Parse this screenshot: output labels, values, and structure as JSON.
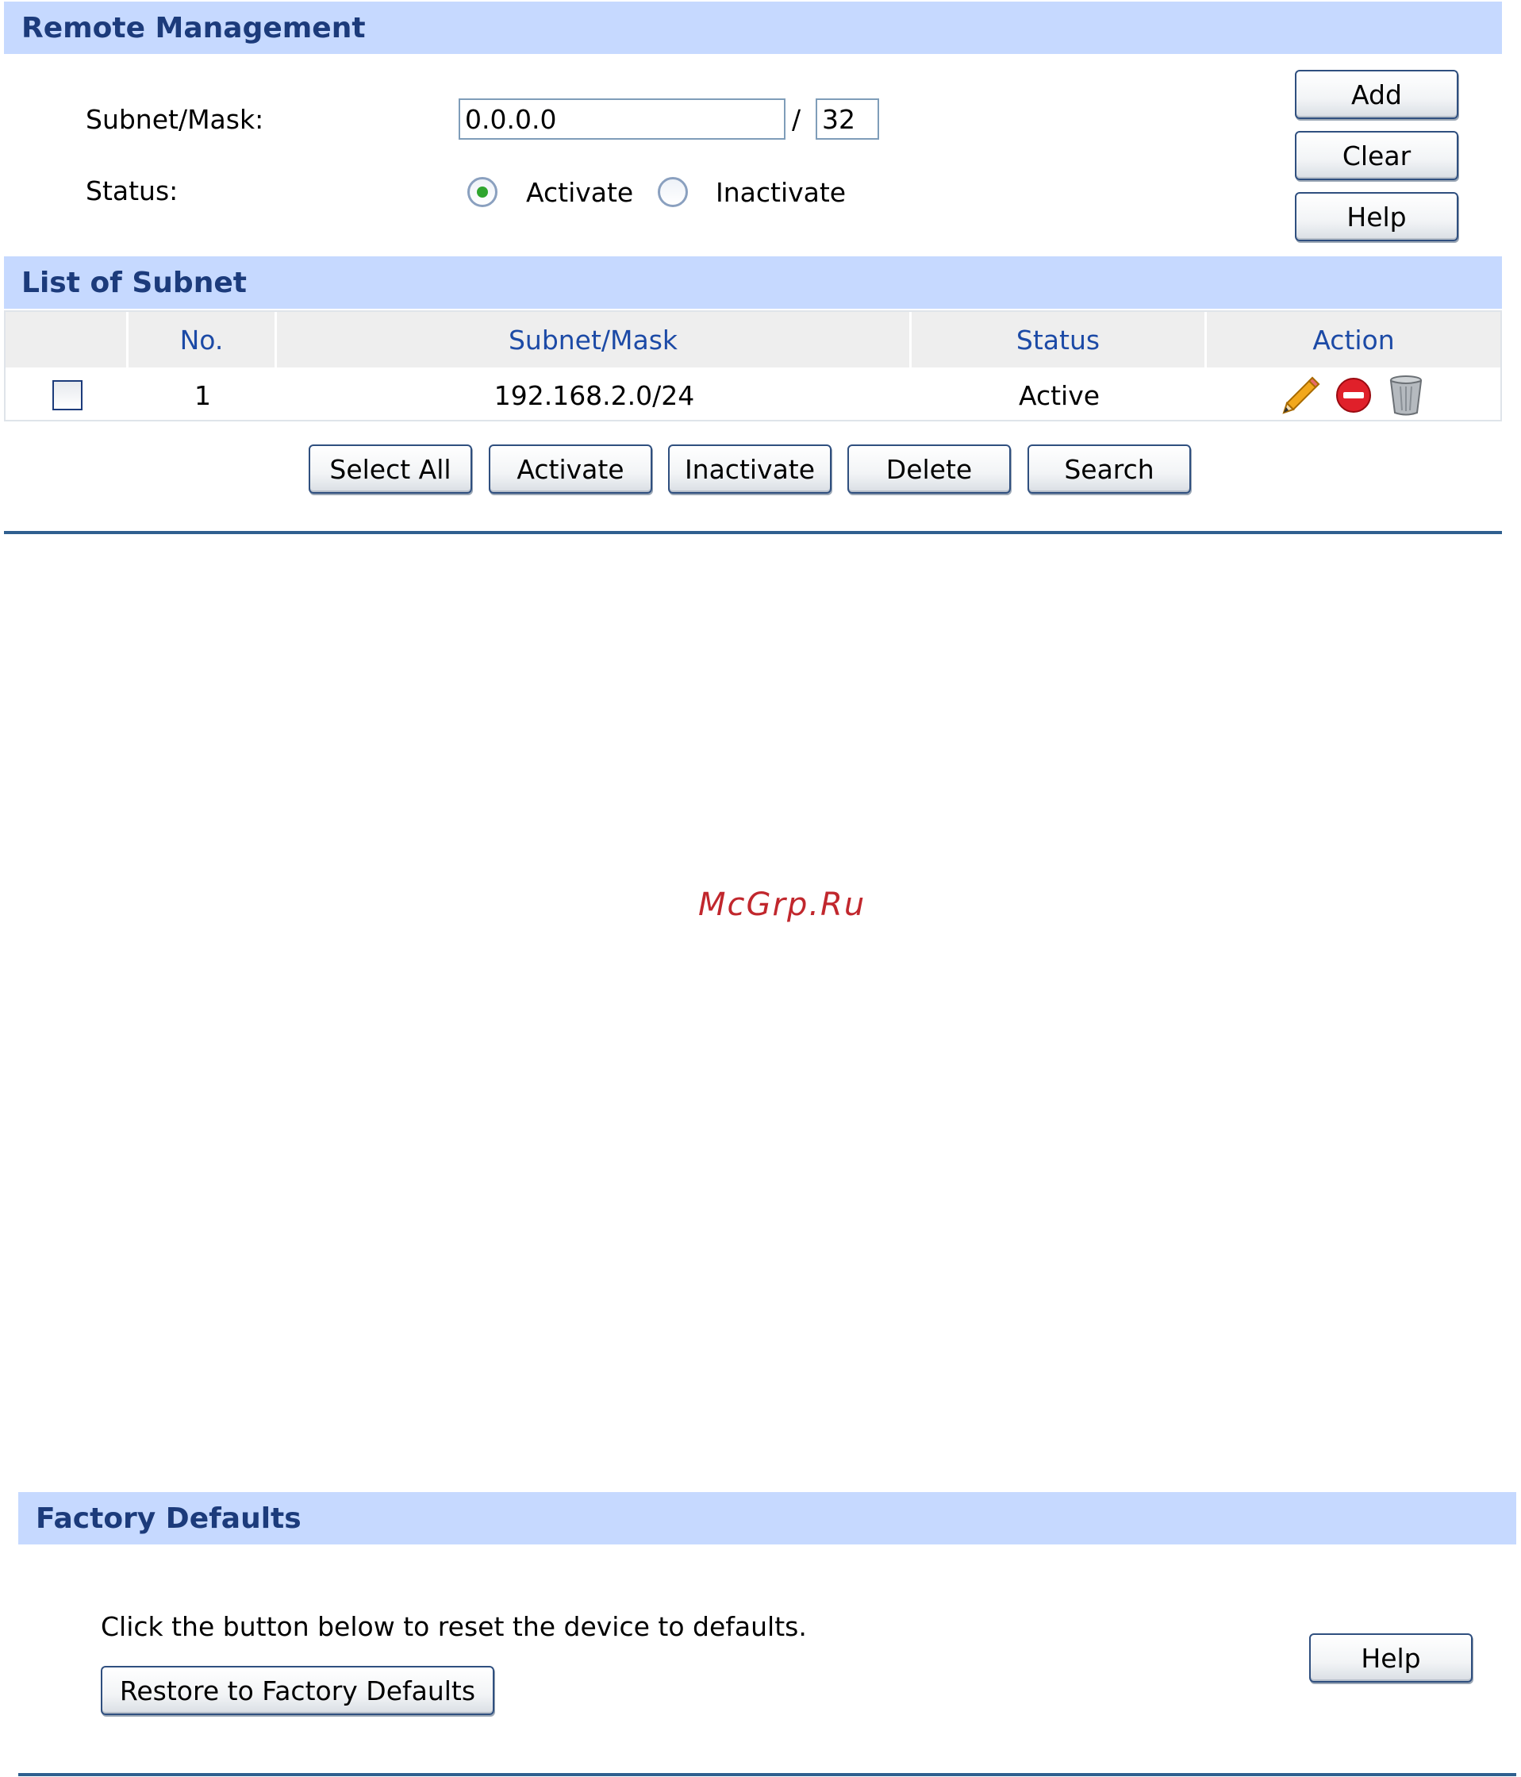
{
  "remote_management": {
    "title": "Remote Management",
    "subnet_mask_label": "Subnet/Mask:",
    "subnet_value": "0.0.0.0",
    "slash": "/",
    "mask_value": "32",
    "status_label": "Status:",
    "activate_label": "Activate",
    "inactivate_label": "Inactivate",
    "status_selected": "Activate",
    "add_label": "Add",
    "clear_label": "Clear",
    "help_label": "Help"
  },
  "subnet_list": {
    "title": "List of Subnet",
    "columns": [
      "No.",
      "Subnet/Mask",
      "Status",
      "Action"
    ],
    "rows": [
      {
        "no": "1",
        "subnet_mask": "192.168.2.0/24",
        "status": "Active",
        "action_icons": [
          "pencil-icon",
          "stop-icon",
          "trash-icon"
        ]
      }
    ],
    "buttons": {
      "select_all": "Select All",
      "activate": "Activate",
      "inactivate": "Inactivate",
      "delete": "Delete",
      "search": "Search"
    }
  },
  "watermark": "McGrp.Ru",
  "factory_defaults": {
    "title": "Factory Defaults",
    "description": "Click the button below to reset the device to defaults.",
    "restore_label": "Restore to Factory Defaults",
    "help_label": "Help"
  },
  "colors": {
    "header_band": "#c6d9ff",
    "header_text": "#1c3b7b",
    "column_header_text": "#1c4aa6",
    "rule": "#2f5f8f",
    "watermark": "#c1272d",
    "radio_selected": "#2fa52f"
  }
}
